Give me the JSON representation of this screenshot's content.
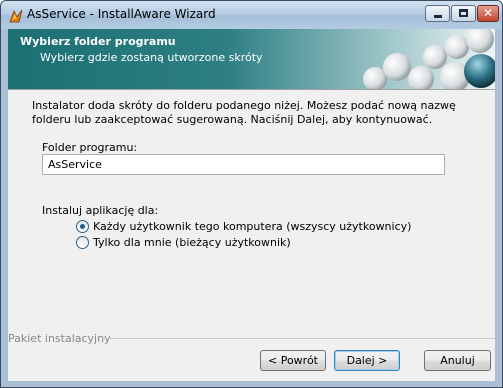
{
  "window": {
    "title": "AsService - InstallAware Wizard"
  },
  "header": {
    "title": "Wybierz folder programu",
    "subtitle": "Wybierz gdzie zostaną utworzone skróty"
  },
  "intro": "Instalator doda skróty do folderu podanego niżej. Możesz podać nową nazwę folderu lub zaakceptować sugerowaną. Naciśnij Dalej, aby kontynuować.",
  "folder": {
    "label": "Folder programu:",
    "value": "AsService"
  },
  "install_for": {
    "label": "Instaluj aplikację dla:",
    "options": [
      {
        "label": "Każdy użytkownik tego komputera (wszyscy użytkownicy)",
        "selected": true
      },
      {
        "label": "Tylko dla mnie (bieżący użytkownik)",
        "selected": false
      }
    ]
  },
  "footer": {
    "text": "Pakiet instalacyjny"
  },
  "buttons": {
    "back": "< Powrót",
    "next": "Dalej >",
    "cancel": "Anuluj"
  }
}
